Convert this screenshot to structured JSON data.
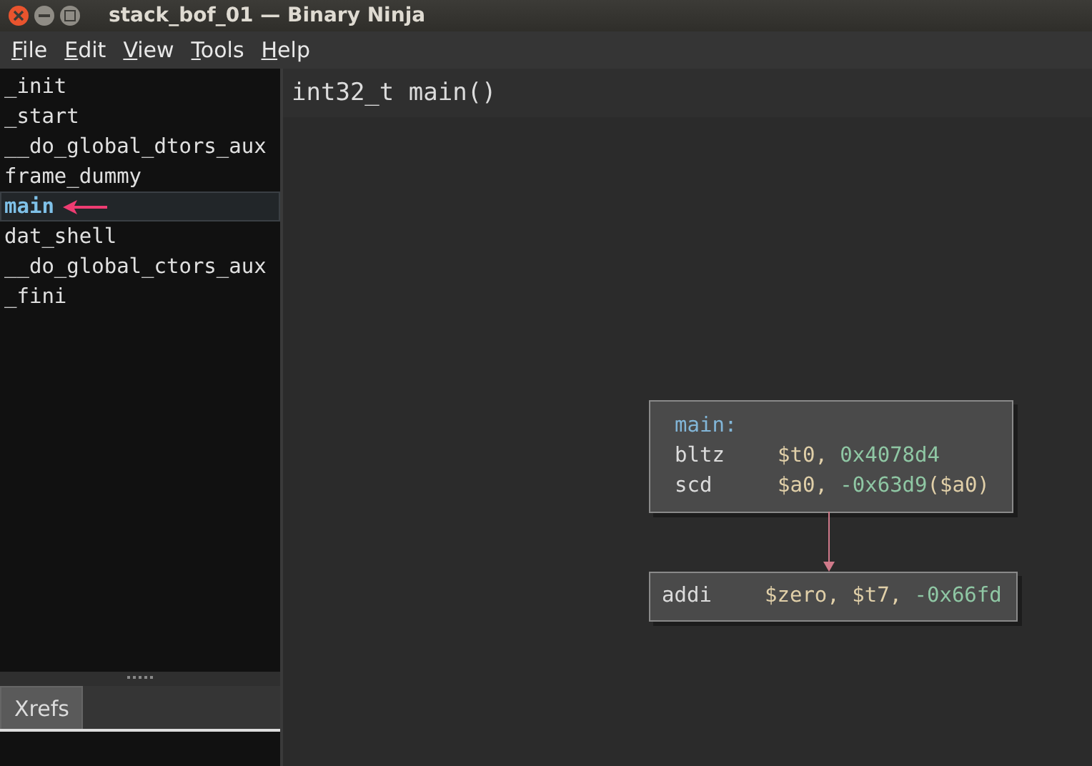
{
  "window": {
    "title": "stack_bof_01 — Binary Ninja"
  },
  "menu": [
    "File",
    "Edit",
    "View",
    "Tools",
    "Help"
  ],
  "functions": [
    {
      "name": "_init",
      "selected": false
    },
    {
      "name": "_start",
      "selected": false
    },
    {
      "name": "__do_global_dtors_aux",
      "selected": false
    },
    {
      "name": "frame_dummy",
      "selected": false
    },
    {
      "name": "main",
      "selected": true
    },
    {
      "name": "dat_shell",
      "selected": false
    },
    {
      "name": "__do_global_ctors_aux",
      "selected": false
    },
    {
      "name": "_fini",
      "selected": false
    }
  ],
  "bottom_tabs": [
    {
      "label": "Xrefs",
      "selected": true
    }
  ],
  "view": {
    "header": "int32_t main()",
    "blocks": [
      {
        "lines": [
          [
            {
              "text": "main:",
              "kind": "label"
            }
          ],
          [
            {
              "text": "bltz",
              "kind": "mnemonic"
            },
            {
              "text": "$t0, ",
              "kind": "operand"
            },
            {
              "text": "0x4078d4",
              "kind": "number"
            }
          ],
          [
            {
              "text": "scd",
              "kind": "mnemonic"
            },
            {
              "text": "$a0, ",
              "kind": "operand"
            },
            {
              "text": "-0x63d9",
              "kind": "number"
            },
            {
              "text": "($a0)",
              "kind": "operand"
            }
          ]
        ]
      },
      {
        "lines": [
          [
            {
              "text": "addi",
              "kind": "mnemonic"
            },
            {
              "text": "$zero, $t7, ",
              "kind": "operand"
            },
            {
              "text": "-0x66fd",
              "kind": "number"
            }
          ]
        ]
      }
    ]
  }
}
